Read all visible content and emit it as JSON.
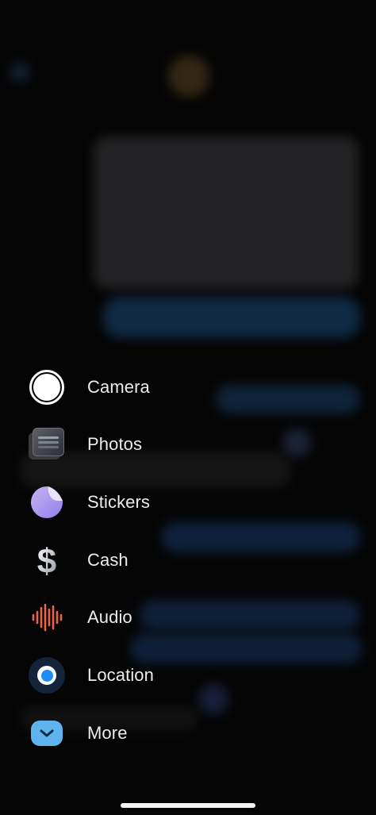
{
  "menu": {
    "items": [
      {
        "id": "camera",
        "label": "Camera",
        "icon": "camera-icon"
      },
      {
        "id": "photos",
        "label": "Photos",
        "icon": "photos-icon"
      },
      {
        "id": "stickers",
        "label": "Stickers",
        "icon": "stickers-icon"
      },
      {
        "id": "cash",
        "label": "Cash",
        "icon": "dollar-icon"
      },
      {
        "id": "audio",
        "label": "Audio",
        "icon": "waveform-icon"
      },
      {
        "id": "location",
        "label": "Location",
        "icon": "location-icon"
      },
      {
        "id": "more",
        "label": "More",
        "icon": "chevron-down-icon"
      }
    ]
  },
  "colors": {
    "background": "#050505",
    "label": "#ececee",
    "audio_accent": "#e8644b",
    "location_blue": "#1e8cf5",
    "more_blue": "#5fb4f0"
  }
}
